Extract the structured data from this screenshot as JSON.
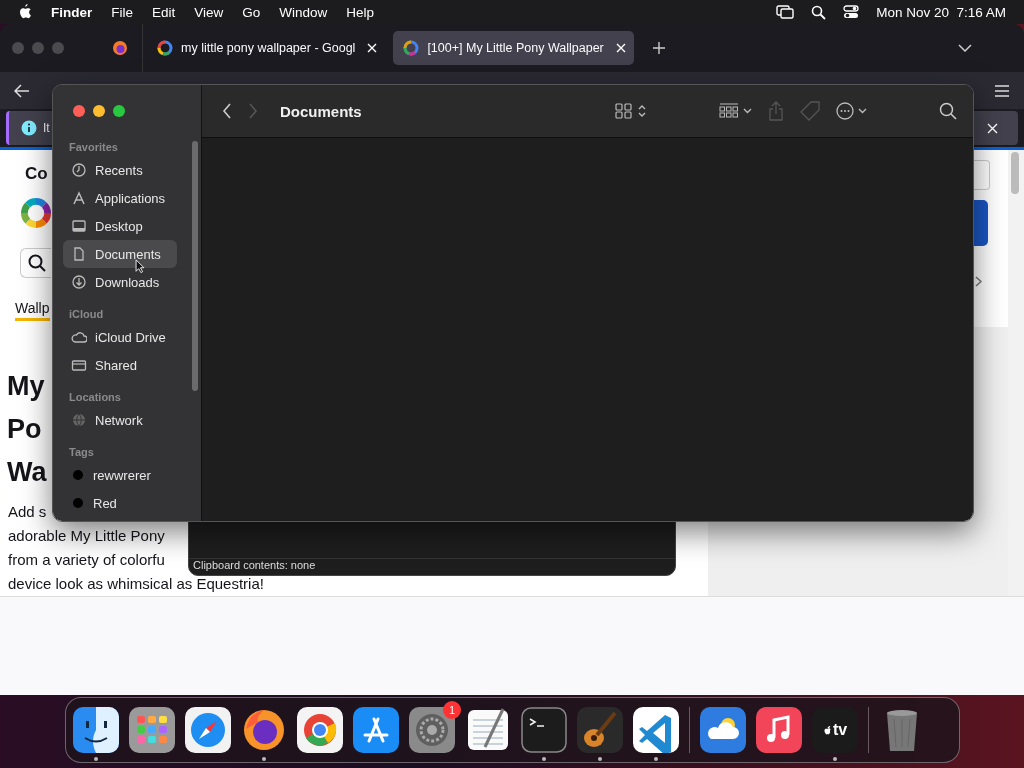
{
  "menu_bar": {
    "app": "Finder",
    "menus": [
      "File",
      "Edit",
      "View",
      "Go",
      "Window",
      "Help"
    ],
    "clock": "Mon Nov 20  7:16 AM"
  },
  "browser": {
    "tabs": [
      {
        "title": "my little pony wallpaper - Googl",
        "selected": false
      },
      {
        "title": "[100+] My Little Pony Wallpaper",
        "selected": true
      }
    ],
    "notification": {
      "text": "It"
    },
    "page": {
      "site_title": "Co",
      "nav_link": "Wallp",
      "heading_lines": [
        "My",
        "Po",
        "Wa"
      ],
      "paragraph_lines": [
        "Add s",
        "adorable My Little Pony",
        "from a variety of colorfu",
        "device look as whimsical as Equestria!"
      ]
    }
  },
  "finder": {
    "title": "Documents",
    "sidebar": [
      {
        "heading": "Favorites",
        "kind": "places",
        "items": [
          {
            "label": "Recents",
            "selected": false
          },
          {
            "label": "Applications",
            "selected": false
          },
          {
            "label": "Desktop",
            "selected": false
          },
          {
            "label": "Documents",
            "selected": true
          },
          {
            "label": "Downloads",
            "selected": false
          }
        ]
      },
      {
        "heading": "iCloud",
        "kind": "places",
        "items": [
          {
            "label": "iCloud Drive",
            "selected": false
          },
          {
            "label": "Shared",
            "selected": false
          }
        ]
      },
      {
        "heading": "Locations",
        "kind": "places",
        "items": [
          {
            "label": "Network",
            "selected": false
          }
        ]
      },
      {
        "heading": "Tags",
        "kind": "tags",
        "items": [
          {
            "label": "rewwrerer",
            "selected": false
          },
          {
            "label": "Red",
            "selected": false
          }
        ]
      }
    ]
  },
  "clipboard": {
    "text": "Clipboard contents: none"
  },
  "dock": {
    "items": [
      {
        "running": true
      },
      {
        "running": false
      },
      {
        "running": false
      },
      {
        "running": true
      },
      {
        "running": false
      },
      {
        "running": false
      },
      {
        "running": false,
        "badge": "1"
      },
      {
        "running": false
      },
      {
        "running": true
      },
      {
        "running": true
      },
      {
        "running": true
      },
      {
        "running": false
      },
      {
        "running": false
      },
      {
        "running": true,
        "label": "tv"
      },
      {
        "running": false
      }
    ]
  }
}
